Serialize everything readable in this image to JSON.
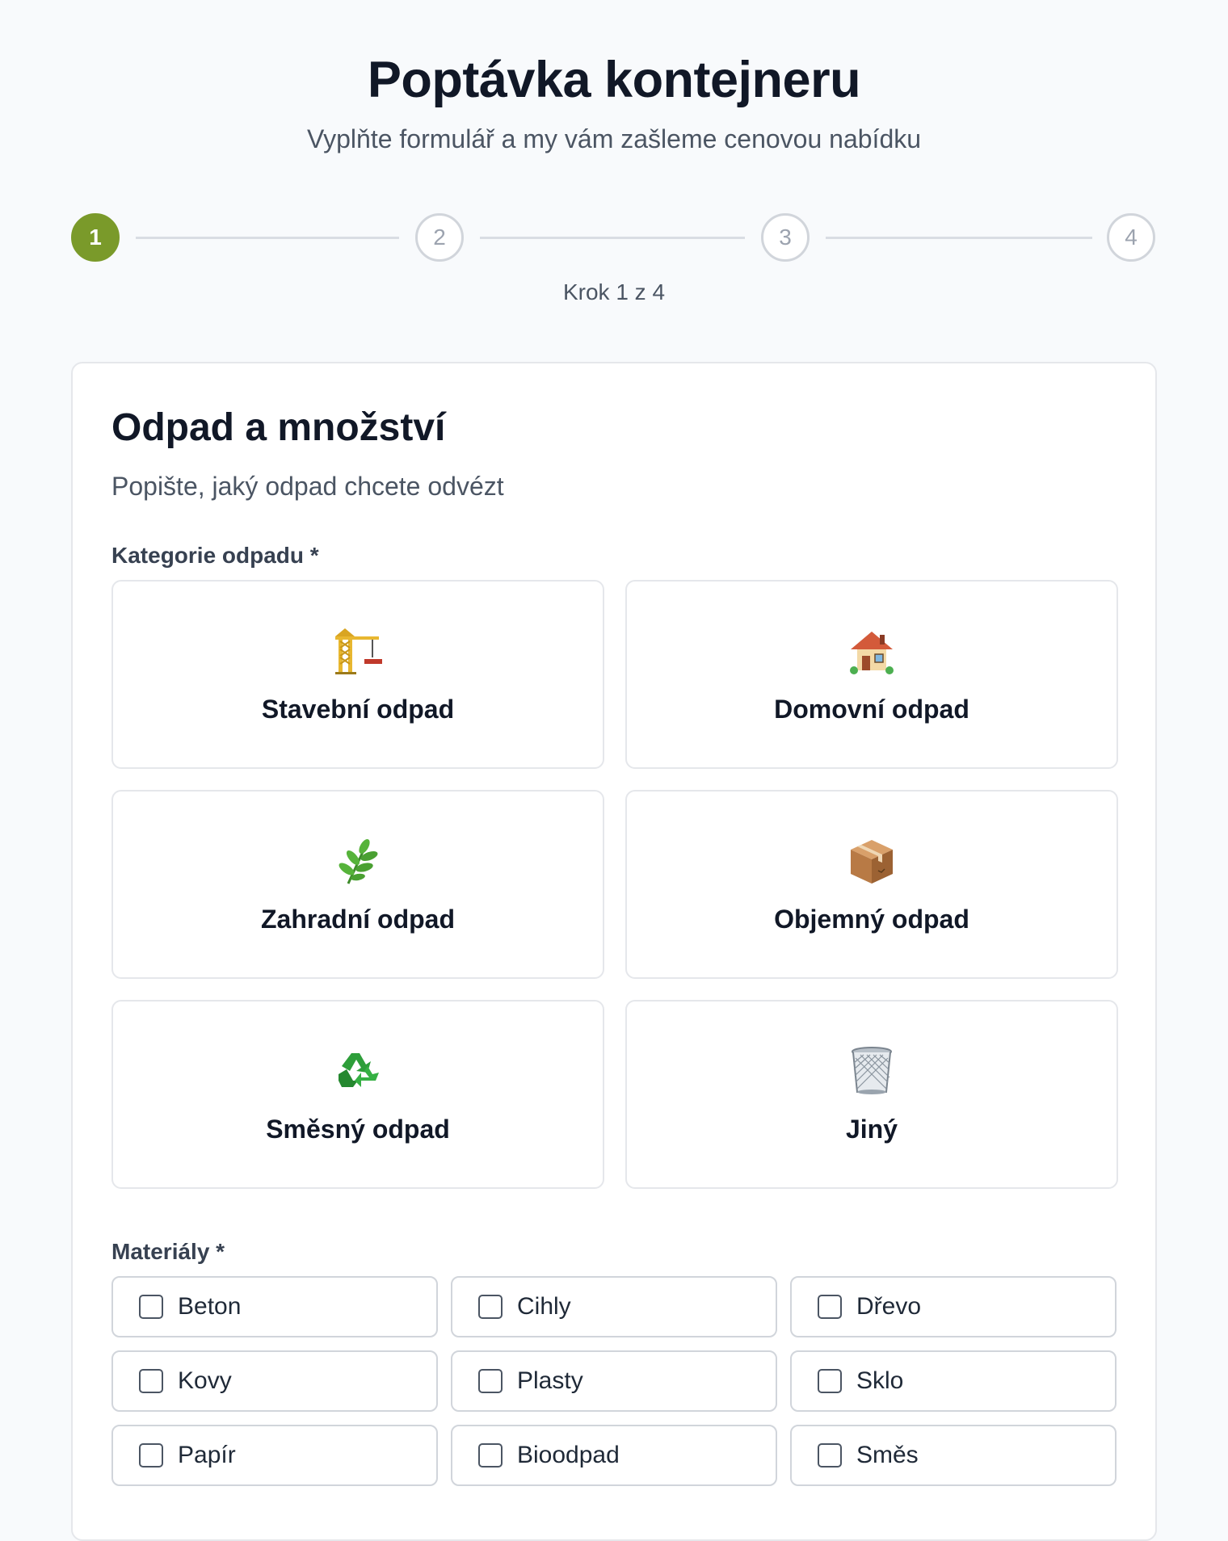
{
  "header": {
    "title": "Poptávka kontejneru",
    "subtitle": "Vyplňte formulář a my vám zašleme cenovou nabídku"
  },
  "stepper": {
    "steps": [
      "1",
      "2",
      "3",
      "4"
    ],
    "current_step": 1,
    "caption": "Krok 1 z 4",
    "active_color": "#7a9a2a"
  },
  "section": {
    "title": "Odpad a množství",
    "subtitle": "Popište, jaký odpad chcete odvézt"
  },
  "categories": {
    "label": "Kategorie odpadu *",
    "items": [
      {
        "label": "Stavební odpad",
        "icon": "construction-crane-icon"
      },
      {
        "label": "Domovní odpad",
        "icon": "house-icon"
      },
      {
        "label": "Zahradní odpad",
        "icon": "herb-leaf-icon"
      },
      {
        "label": "Objemný odpad",
        "icon": "package-box-icon"
      },
      {
        "label": "Směsný odpad",
        "icon": "recycle-icon"
      },
      {
        "label": "Jiný",
        "icon": "wastebasket-icon"
      }
    ]
  },
  "materials": {
    "label": "Materiály *",
    "items": [
      {
        "label": "Beton",
        "checked": false
      },
      {
        "label": "Cihly",
        "checked": false
      },
      {
        "label": "Dřevo",
        "checked": false
      },
      {
        "label": "Kovy",
        "checked": false
      },
      {
        "label": "Plasty",
        "checked": false
      },
      {
        "label": "Sklo",
        "checked": false
      },
      {
        "label": "Papír",
        "checked": false
      },
      {
        "label": "Bioodpad",
        "checked": false
      },
      {
        "label": "Směs",
        "checked": false
      }
    ]
  }
}
